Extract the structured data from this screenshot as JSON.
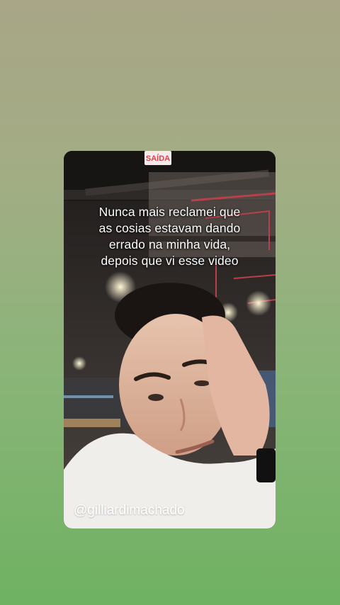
{
  "story": {
    "caption_lines": [
      "Nunca mais reclamei que",
      "as cosias estavam dando",
      "errado na minha vida,",
      "depois que vi esse video"
    ],
    "handle": "@gilliardimachado",
    "exit_sign": "SAÍDA"
  },
  "colors": {
    "bg_top": "#a8a686",
    "bg_bottom": "#6fb262",
    "exit_sign_red": "#d9434c",
    "caption_text": "#ffffff"
  }
}
